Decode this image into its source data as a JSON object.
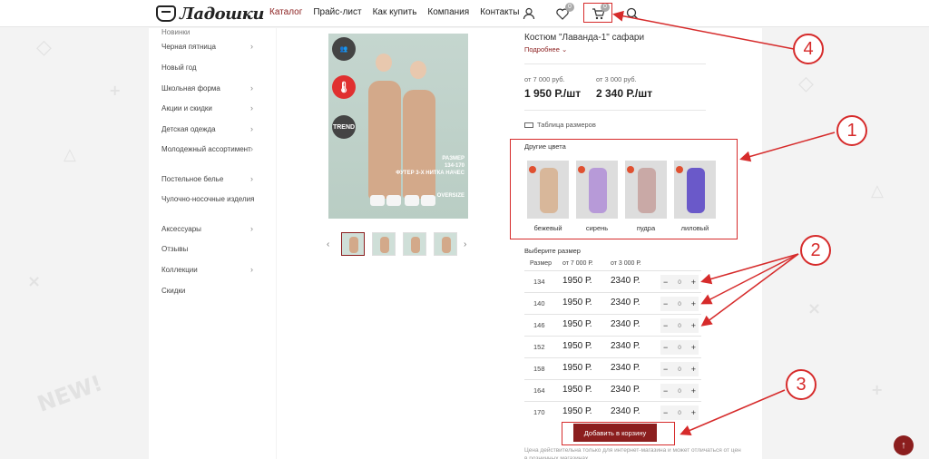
{
  "header": {
    "logo_text": "Ладошки",
    "nav": [
      "Каталог",
      "Прайс-лист",
      "Как купить",
      "Компания",
      "Контакты"
    ],
    "wishlist_count": "0",
    "cart_count": "0"
  },
  "sidebar": {
    "cut_item": "Новинки",
    "items": [
      {
        "label": "Черная пятница",
        "has_children": true
      },
      {
        "label": "Новый год",
        "has_children": false
      },
      {
        "label": "Школьная форма",
        "has_children": true
      },
      {
        "label": "Акции и скидки",
        "has_children": true
      },
      {
        "label": "Детская одежда",
        "has_children": true
      },
      {
        "label": "Молодежный ассортимент",
        "has_children": true
      },
      {
        "label": "Постельное белье",
        "has_children": true
      },
      {
        "label": "Чулочно-носочные изделия",
        "has_children": true
      },
      {
        "label": "Аксессуары",
        "has_children": true
      },
      {
        "label": "Отзывы",
        "has_children": false
      },
      {
        "label": "Коллекции",
        "has_children": true
      },
      {
        "label": "Скидки",
        "has_children": false
      }
    ]
  },
  "product": {
    "title": "Костюм \"Лаванда-1\" сафари",
    "more_link": "Подробнее",
    "price_caption_1": "от 7 000 руб.",
    "price_caption_2": "от 3 000 руб.",
    "price_1": "1 950 Р./шт",
    "price_2": "2 340 Р./шт",
    "sizes_table_link": "Таблица размеров",
    "image_badges": {
      "trend": "TREND",
      "size": "РАЗМЕР",
      "size_range": "134-170",
      "material": "ФУТЕР 3-Х НИТКА НАЧЕС",
      "oversize": "OVERSIZE"
    }
  },
  "colors": {
    "title": "Другие цвета",
    "items": [
      {
        "label": "бежевый",
        "color": "#d8b79a"
      },
      {
        "label": "сирень",
        "color": "#b79ad8"
      },
      {
        "label": "пудра",
        "color": "#c9a9a6"
      },
      {
        "label": "лиловый",
        "color": "#6a59c9"
      }
    ]
  },
  "sizes": {
    "title": "Выберите размер",
    "headers": [
      "Размер",
      "от 7 000 Р.",
      "от 3 000 Р."
    ],
    "rows": [
      {
        "size": "134",
        "p1": "1950 Р.",
        "p2": "2340 Р.",
        "qty": "0"
      },
      {
        "size": "140",
        "p1": "1950 Р.",
        "p2": "2340 Р.",
        "qty": "0"
      },
      {
        "size": "146",
        "p1": "1950 Р.",
        "p2": "2340 Р.",
        "qty": "0"
      },
      {
        "size": "152",
        "p1": "1950 Р.",
        "p2": "2340 Р.",
        "qty": "0"
      },
      {
        "size": "158",
        "p1": "1950 Р.",
        "p2": "2340 Р.",
        "qty": "0"
      },
      {
        "size": "164",
        "p1": "1950 Р.",
        "p2": "2340 Р.",
        "qty": "0"
      },
      {
        "size": "170",
        "p1": "1950 Р.",
        "p2": "2340 Р.",
        "qty": "0"
      }
    ],
    "minus": "−",
    "plus": "+"
  },
  "cta": {
    "add_to_cart": "Добавить в корзину",
    "note": "Цена действительна только для интернет-магазина и может отличаться от цен в розничных магазинах"
  },
  "annotations": [
    "1",
    "2",
    "3",
    "4"
  ],
  "accent": "#8b1e1e",
  "annotation_color": "#d62b2b"
}
